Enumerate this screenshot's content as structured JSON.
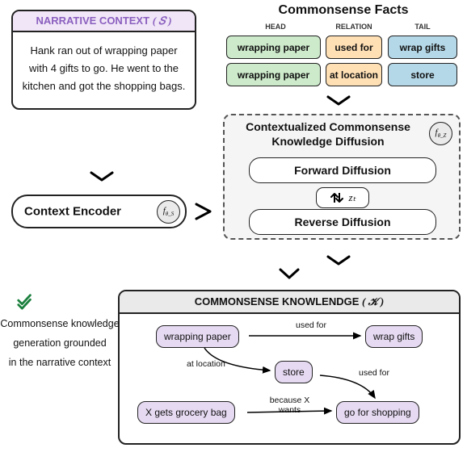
{
  "narrative": {
    "header": "NARRATIVE CONTEXT",
    "symbol": "( 𝑆 )",
    "text": "Hank ran out of wrapping paper with 4 gifts to go. He went to the kitchen and got the shopping bags."
  },
  "context_encoder": {
    "label": "Context Encoder",
    "f_symbol": "f",
    "f_sub": "θ_S"
  },
  "facts": {
    "title": "Commonsense Facts",
    "head_label": "HEAD",
    "relation_label": "RELATION",
    "tail_label": "TAIL",
    "heads": [
      "wrapping paper",
      "wrapping paper"
    ],
    "relations": [
      "used for",
      "at location"
    ],
    "tails": [
      "wrap gifts",
      "store"
    ]
  },
  "diffusion": {
    "title": "Contextualized Commonsense Knowledge Diffusion",
    "forward": "Forward Diffusion",
    "reverse": "Reverse Diffusion",
    "z_symbol": "zₜ",
    "f_symbol": "f",
    "f_sub": "θ_Z"
  },
  "knowledge": {
    "header": "COMMONSENSE KNOWLENDGE",
    "symbol": "( 𝒦 )",
    "nodes": {
      "wrapping_paper": "wrapping paper",
      "wrap_gifts": "wrap gifts",
      "store": "store",
      "grocery_bag": "X gets grocery bag",
      "go_shopping": "go for shopping"
    },
    "edges": {
      "used_for": "used for",
      "at_location": "at location",
      "because_wants": "because X wants"
    }
  },
  "caption": {
    "line1": "Commonsense knowledge",
    "line2": "generation grounded",
    "line3": "in the narrative context"
  }
}
